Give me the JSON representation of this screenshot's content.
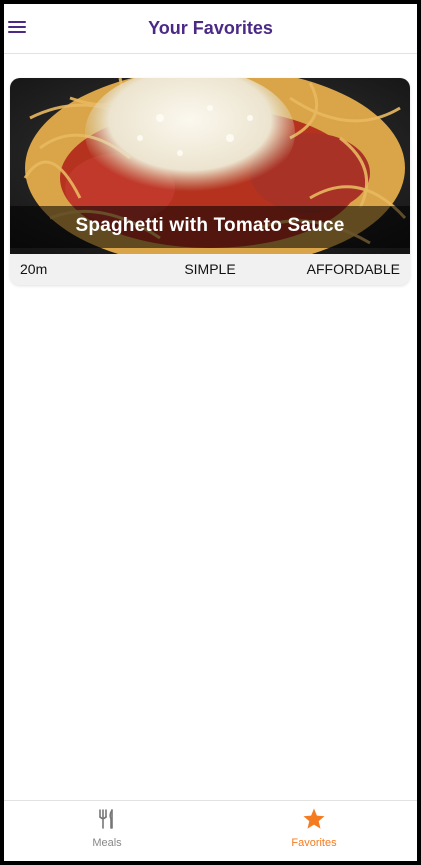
{
  "header": {
    "title": "Your Favorites",
    "menu_icon": "menu-icon"
  },
  "meals": [
    {
      "title": "Spaghetti with Tomato Sauce",
      "duration": "20m",
      "complexity": "SIMPLE",
      "affordability": "AFFORDABLE"
    }
  ],
  "tabs": [
    {
      "label": "Meals",
      "icon": "fork-knife-icon",
      "active": false
    },
    {
      "label": "Favorites",
      "icon": "star-icon",
      "active": true
    }
  ],
  "colors": {
    "primary": "#4b2a86",
    "accent": "#f47b20",
    "inactive": "#888888"
  }
}
